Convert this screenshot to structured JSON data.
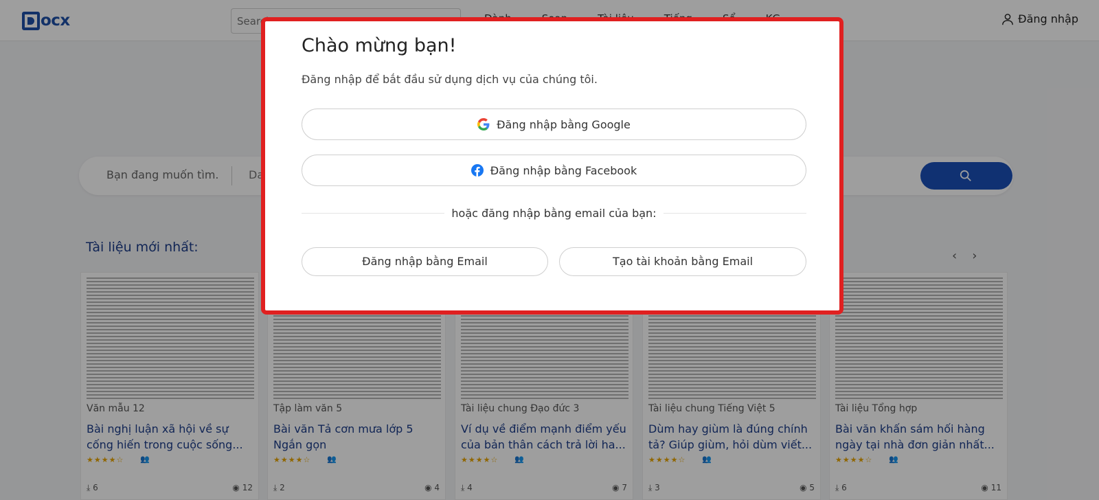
{
  "header": {
    "logo_text": "ocx",
    "search_placeholder": "Search",
    "nav": [
      "Dành",
      "Soạn",
      "Tài liệu",
      "Tiếng",
      "Sổ",
      "KG"
    ],
    "login_label": "Đăng nhập"
  },
  "hero_search": {
    "query_placeholder": "Bạn đang muốn tìm.",
    "category_placeholder": "Da"
  },
  "section": {
    "title": "Tài liệu mới nhất:"
  },
  "cards": [
    {
      "category": "Văn mẫu 12",
      "title": "Bài nghị luận xã hội về sự cống hiến trong cuộc sống...",
      "rating": "★★★★☆",
      "downloads": "6",
      "views": "12"
    },
    {
      "category": "Tập làm văn 5",
      "title": "Bài văn Tả cơn mưa lớp 5 Ngắn gọn",
      "rating": "★★★★☆",
      "downloads": "2",
      "views": "4"
    },
    {
      "category": "Tài liệu chung Đạo đức 3",
      "title": "Ví dụ về điểm mạnh điểm yếu của bản thân cách trả lời ha...",
      "rating": "★★★★☆",
      "downloads": "4",
      "views": "7"
    },
    {
      "category": "Tài liệu chung Tiếng Việt 5",
      "title": "Dùm hay giùm là đúng chính tả? Giúp giùm, hỏi dùm viết...",
      "rating": "★★★★☆",
      "downloads": "3",
      "views": "5"
    },
    {
      "category": "Tài liệu Tổng hợp",
      "title": "Bài văn khấn sám hối hàng ngày tại nhà đơn giản nhất...",
      "rating": "★★★★☆",
      "downloads": "6",
      "views": "11"
    }
  ],
  "modal": {
    "title": "Chào mừng bạn!",
    "subtitle": "Đăng nhập để bắt đầu sử dụng dịch vụ của chúng tôi.",
    "google_label": "Đăng nhập bằng Google",
    "facebook_label": "Đăng nhập bằng Facebook",
    "divider_text": "hoặc đăng nhập bằng email của bạn:",
    "email_login_label": "Đăng nhập bằng Email",
    "email_create_label": "Tạo tài khoản bằng Email"
  },
  "colors": {
    "brand": "#1e4fa8",
    "highlight_border": "#e02020",
    "facebook": "#1877f2",
    "star": "#e8a500"
  }
}
